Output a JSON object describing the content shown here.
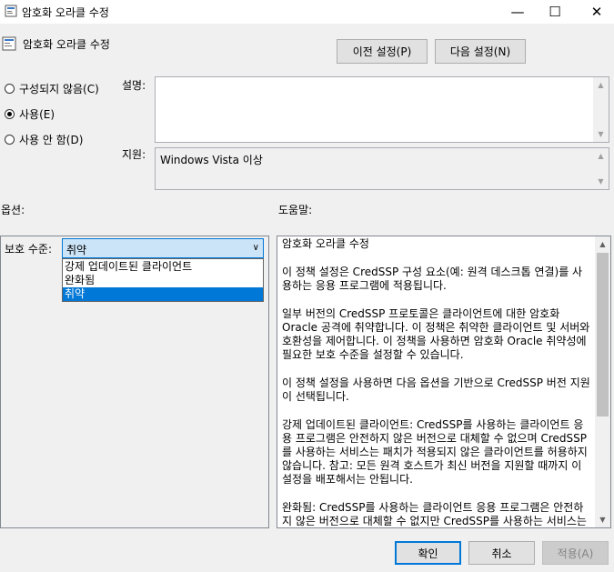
{
  "window": {
    "title": "암호화 오라클 수정",
    "icon": "policy-setting-icon",
    "controls": {
      "minimize": "—",
      "maximize": "☐",
      "close": "✕"
    }
  },
  "header": {
    "setting_name": "암호화 오라클 수정",
    "prev_button": "이전 설정(P)",
    "next_button": "다음 설정(N)"
  },
  "state": {
    "options": [
      {
        "label": "구성되지 않음(C)",
        "selected": false
      },
      {
        "label": "사용(E)",
        "selected": true
      },
      {
        "label": "사용 안 함(D)",
        "selected": false
      }
    ]
  },
  "comment": {
    "label": "설명:",
    "value": ""
  },
  "supported": {
    "label": "지원:",
    "value": "Windows Vista 이상"
  },
  "options_section": {
    "label": "옵션:",
    "protection_label": "보호 수준:",
    "protection_value": "취약",
    "dropdown_options": [
      "강제 업데이트된 클라이언트",
      "완화됨",
      "취약"
    ],
    "dropdown_selected_index": 2
  },
  "help_section": {
    "label": "도움말:",
    "paragraphs": [
      "암호화 오라클 수정",
      "이 정책 설정은 CredSSP 구성 요소(예: 원격 데스크톱 연결)를 사용하는 응용 프로그램에 적용됩니다.",
      "일부 버전의 CredSSP 프로토콜은 클라이언트에 대한 암호화 Oracle 공격에 취약합니다. 이 정책은 취약한 클라이언트 및 서버와 호환성을 제어합니다. 이 정책을 사용하면 암호화 Oracle 취약성에 필요한 보호 수준을 설정할 수 있습니다.",
      "이 정책 설정을 사용하면 다음 옵션을 기반으로 CredSSP 버전 지원이 선택됩니다.",
      "강제 업데이트된 클라이언트: CredSSP를 사용하는 클라이언트 응용 프로그램은 안전하지 않은 버전으로 대체할 수 없으며 CredSSP를 사용하는 서비스는 패치가 적용되지 않은 클라이언트를 허용하지 않습니다. 참고: 모든 원격 호스트가 최신 버전을 지원할 때까지 이 설정을 배포해서는 안됩니다.",
      "완화됨: CredSSP를 사용하는 클라이언트 응용 프로그램은 안전하지 않은 버전으로 대체할 수 없지만 CredSSP를 사용하는 서비스는 패치가 적용되지 않은 클라이언트를 허용합니다. 패치가 적"
    ]
  },
  "footer": {
    "ok": "확인",
    "cancel": "취소",
    "apply": "적용(A)"
  }
}
